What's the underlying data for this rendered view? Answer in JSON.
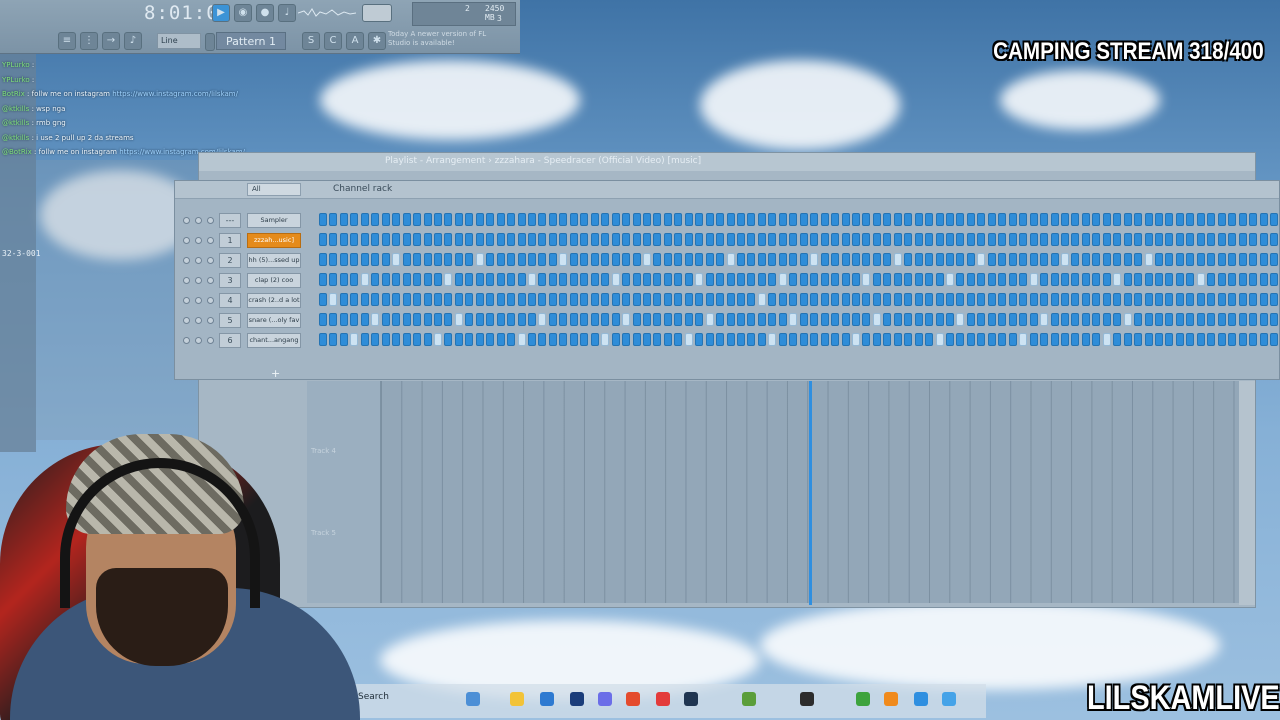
{
  "stream": {
    "title": "CAMPING STREAM 318/400",
    "brand": "LILSKAMLIVE"
  },
  "toolbar": {
    "clock": "8:01:02",
    "pattern": "Pattern 1",
    "line_mode": "Line",
    "memory": "2450 MB",
    "cpu_val_a": "2",
    "cpu_val_b": "3",
    "update_note": "Today  A newer version of FL Studio is available!"
  },
  "chat": [
    {
      "user": "YPLurko",
      "msg": ":"
    },
    {
      "user": "YPLurko",
      "msg": ":"
    },
    {
      "user": "BotRix",
      "msg": ": follw me on instagram",
      "link": "https://www.instagram.com/lilskam/"
    },
    {
      "user": "@ktkills",
      "msg": ": wsp nga"
    },
    {
      "user": "@ktkills",
      "msg": ": rmb gng"
    },
    {
      "user": "@ktkills",
      "msg": ": i use 2 pull up 2 da streams"
    },
    {
      "user": "@BotRix",
      "msg": ": follw me on instagram",
      "link": "https://www.instagram.com/lilskam/"
    }
  ],
  "position_readout": "32-3-001",
  "playlist": {
    "title": "Playlist - Arrangement › zzzahara - Speedracer (Official Video) [music]",
    "tracks": [
      "Track 4",
      "Track 5"
    ]
  },
  "rack": {
    "title": "Channel rack",
    "filter": "All",
    "channels": [
      {
        "num": "---",
        "name": "Sampler",
        "selected": false
      },
      {
        "num": "1",
        "name": "zzzah...usic]",
        "selected": true
      },
      {
        "num": "2",
        "name": "hh (5)...ssed up",
        "selected": false
      },
      {
        "num": "3",
        "name": "clap (2) coo",
        "selected": false
      },
      {
        "num": "4",
        "name": "crash (2..d a lot",
        "selected": false
      },
      {
        "num": "5",
        "name": "snare (...oly fav",
        "selected": false
      },
      {
        "num": "6",
        "name": "chant...angang",
        "selected": false
      }
    ],
    "add_label": "+"
  },
  "taskbar": {
    "search": "Search"
  },
  "colors": {
    "step_on": "#2f8dd8",
    "selected_channel": "#e58b1b",
    "playhead": "#2f8fe0"
  }
}
